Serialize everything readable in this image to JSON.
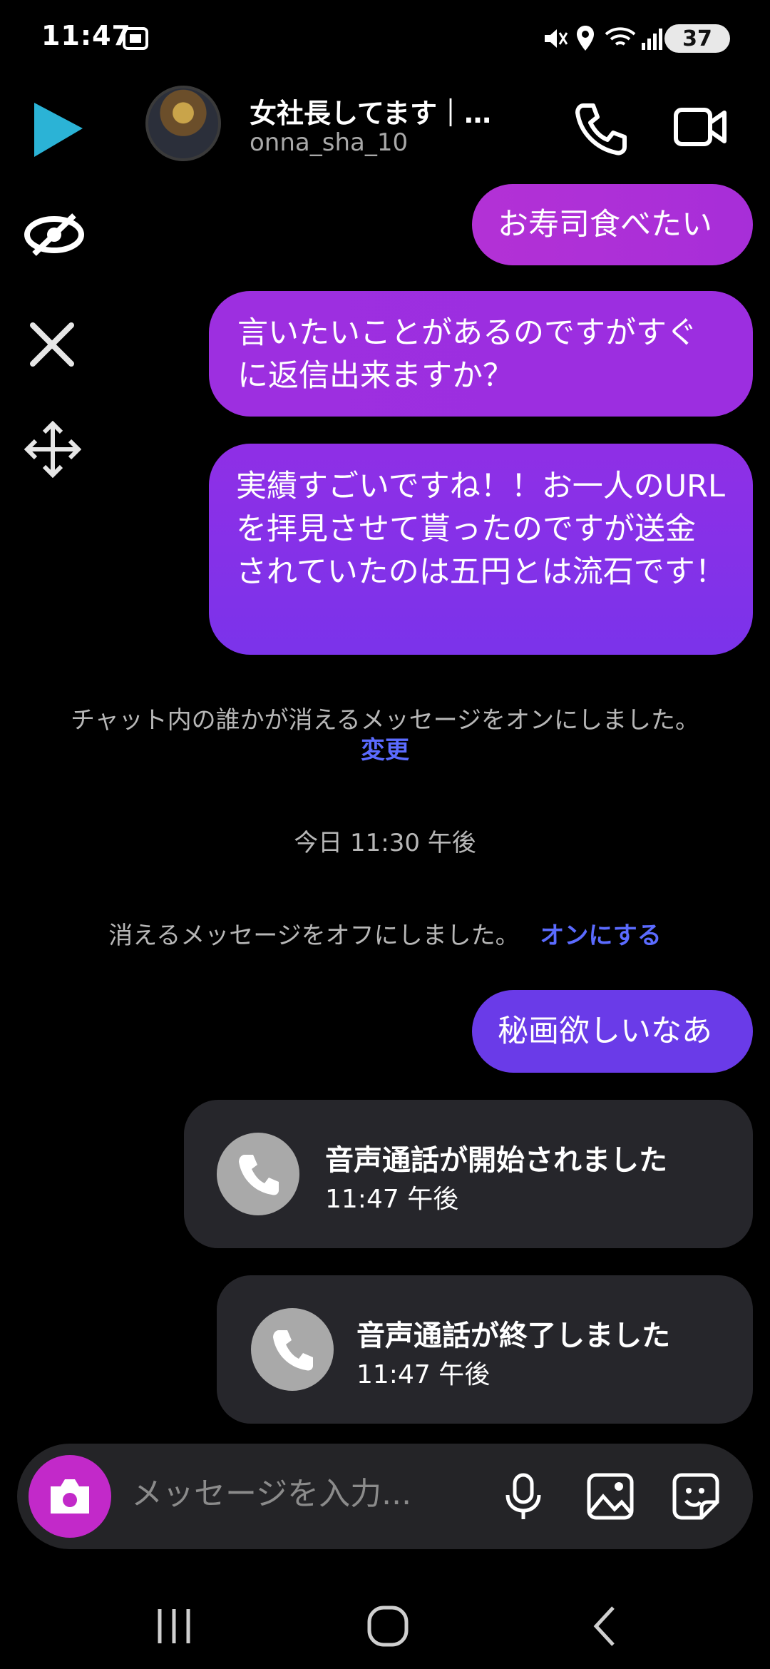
{
  "status_bar": {
    "time": "11:47",
    "battery": "37"
  },
  "header": {
    "title": "女社長してます｜…",
    "username": "onna_sha_10"
  },
  "messages": [
    {
      "text": "お寿司食べたい"
    },
    {
      "text": "言いたいことがあるのですがすぐに返信出来ますか？"
    },
    {
      "text": "実績すごいですね！！お一人のURLを拝見させて貰ったのですが送金されていたのは五円とは流石です！"
    }
  ],
  "system_notices": {
    "vanish_on": "チャット内の誰かが消えるメッセージをオンにしました。",
    "vanish_on_link": "変更",
    "timestamp": "今日 11:30 午後",
    "vanish_off": "消えるメッセージをオフにしました。",
    "vanish_off_link": "オンにする"
  },
  "message_after": {
    "text": "秘画欲しいなあ"
  },
  "calls": [
    {
      "title": "音声通話が開始されました",
      "time": "11:47 午後"
    },
    {
      "title": "音声通話が終了しました",
      "time": "11:47 午後"
    }
  ],
  "composer": {
    "placeholder": "メッセージを入力..."
  },
  "colors": {
    "accent_link": "#5b6bff",
    "camera_button": "#c229c9",
    "bubble_purple": "#9d2fe0",
    "bubble_violet": "#6a3be8"
  }
}
